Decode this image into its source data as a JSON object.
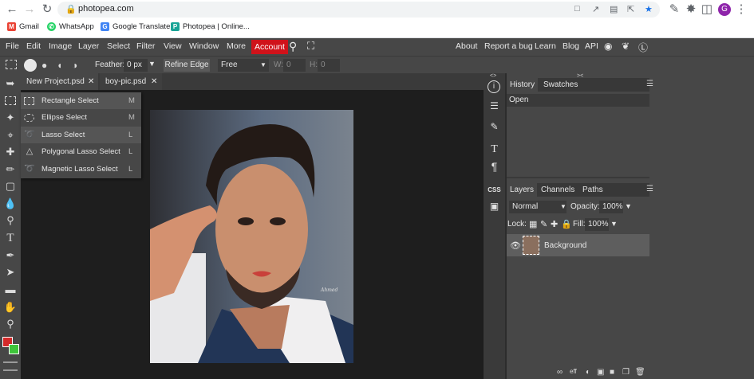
{
  "browser": {
    "url": "photopea.com",
    "profile_initial": "G",
    "bookmarks": [
      {
        "label": "Gmail",
        "color": "#ea4335"
      },
      {
        "label": "WhatsApp",
        "color": "#25d366"
      },
      {
        "label": "Google Translate",
        "color": "#4285f4"
      },
      {
        "label": "Photopea | Online...",
        "color": "#18a497"
      }
    ]
  },
  "menu": {
    "items": [
      "File",
      "Edit",
      "Image",
      "Layer",
      "Select",
      "Filter",
      "View",
      "Window",
      "More"
    ],
    "account": "Account",
    "right": [
      "About",
      "Report a bug",
      "Learn",
      "Blog",
      "API"
    ]
  },
  "options": {
    "feather_label": "Feather:",
    "feather_value": "0 px",
    "refine_edge": "Refine Edge",
    "style_value": "Free",
    "w_label": "W:",
    "w_value": "0",
    "h_label": "H:",
    "h_value": "0"
  },
  "documents": {
    "tabs": [
      "New Project.psd",
      "boy-pic.psd"
    ]
  },
  "tool_menu": {
    "items": [
      {
        "label": "Rectangle Select",
        "key": "M"
      },
      {
        "label": "Ellipse Select",
        "key": "M"
      },
      {
        "label": "Lasso Select",
        "key": "L"
      },
      {
        "label": "Polygonal Lasso Select",
        "key": "L"
      },
      {
        "label": "Magnetic Lasso Select",
        "key": "L"
      }
    ]
  },
  "history_panel": {
    "tabs": [
      "History",
      "Swatches"
    ],
    "items": [
      "Open"
    ]
  },
  "layers_panel": {
    "tabs": [
      "Layers",
      "Channels",
      "Paths"
    ],
    "blend_mode": "Normal",
    "opacity_label": "Opacity:",
    "opacity_value": "100%",
    "lock_label": "Lock:",
    "fill_label": "Fill:",
    "fill_value": "100%",
    "layers": [
      {
        "name": "Background"
      }
    ]
  },
  "photo": {
    "signature": "Ahmed"
  },
  "colors": {
    "foreground": "#d42a2a",
    "background": "#3ec43a",
    "account": "#d0121a"
  }
}
